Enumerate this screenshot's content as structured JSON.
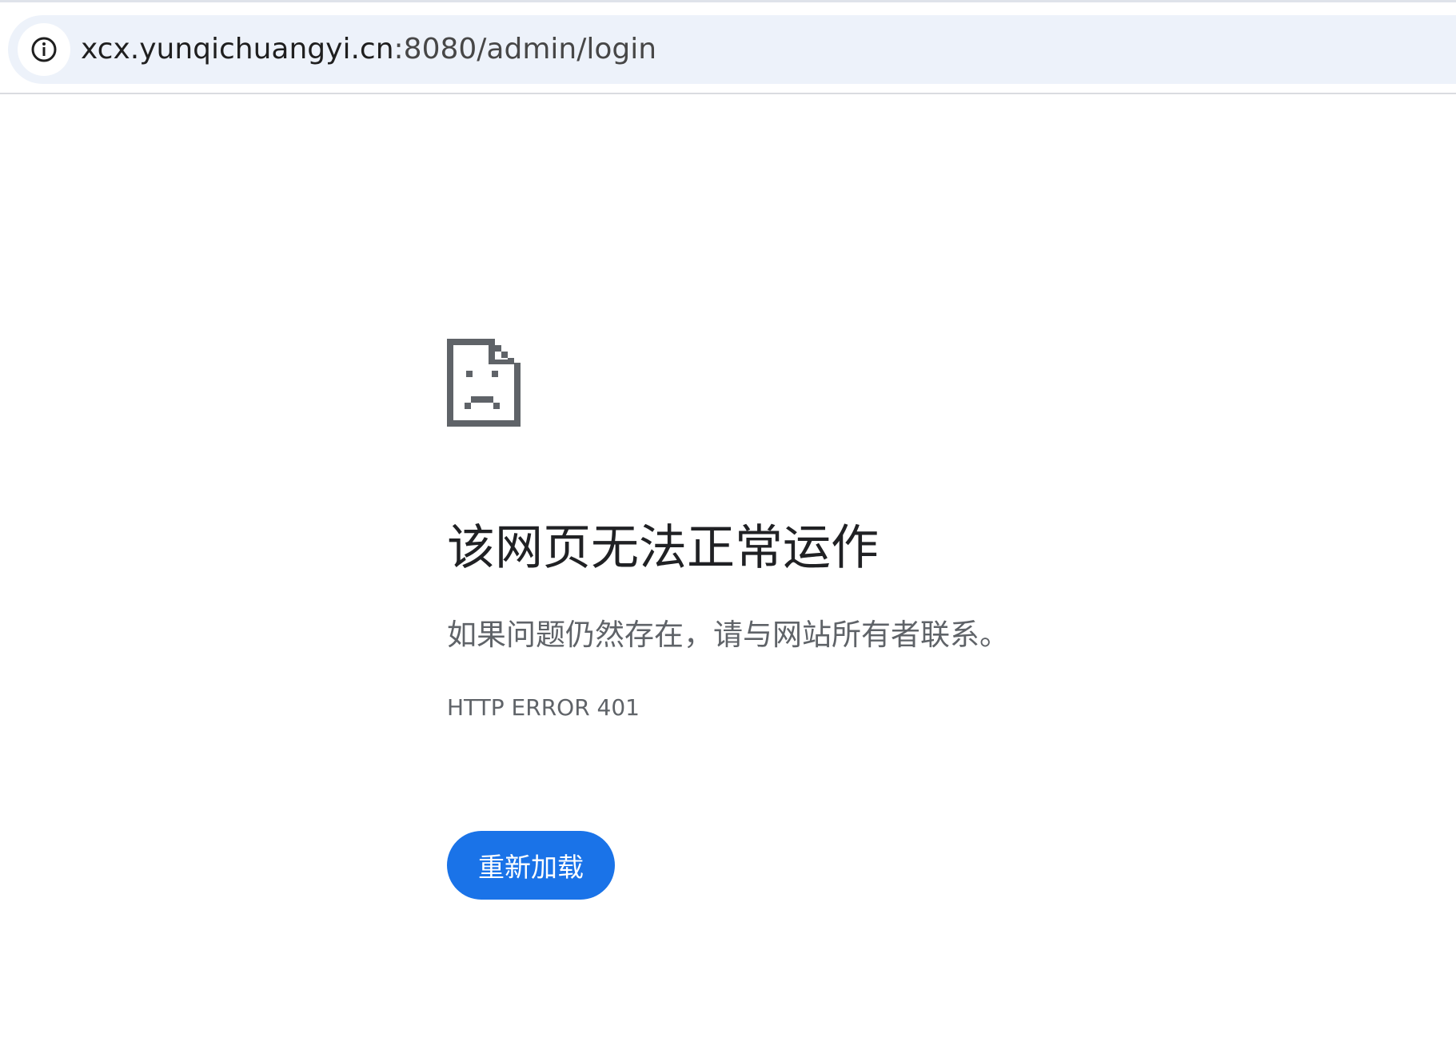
{
  "address_bar": {
    "url_host": "xcx.yunqichuangyi.cn",
    "url_rest": ":8080/admin/login",
    "site_info_icon": "info-circle-icon"
  },
  "error_page": {
    "icon": "sad-page-icon",
    "title": "该网页无法正常运作",
    "subtitle": "如果问题仍然存在，请与网站所有者联系。",
    "error_code": "HTTP ERROR 401",
    "reload_label": "重新加载"
  },
  "colors": {
    "accent": "#1a73e8",
    "omnibox_bg": "#edf2fa",
    "icon_gray": "#5f6368"
  }
}
